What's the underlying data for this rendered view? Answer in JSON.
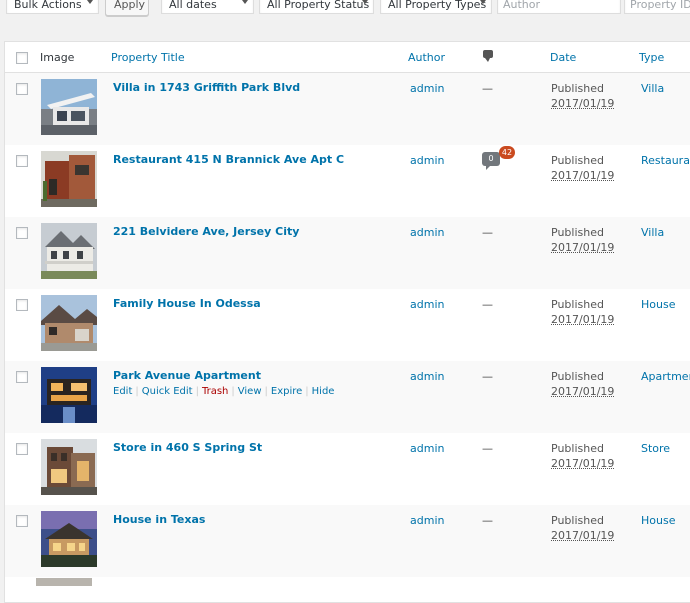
{
  "filters": {
    "bulk_actions": "Bulk Actions",
    "apply": "Apply",
    "dates": "All dates",
    "status": "All Property Status",
    "types": "All Property Types",
    "author_placeholder": "Author",
    "property_id_placeholder": "Property ID"
  },
  "columns": {
    "image": "Image",
    "title": "Property Title",
    "author": "Author",
    "comments_icon": "comment-bubble-icon",
    "date": "Date",
    "type": "Type"
  },
  "rows": [
    {
      "title": "Villa in 1743 Griffith Park Blvd",
      "author": "admin",
      "comments": "—",
      "status": "Published",
      "date": "2017/01/19",
      "type": "Villa"
    },
    {
      "title": "Restaurant 415 N Brannick Ave Apt C",
      "author": "admin",
      "comments": "0",
      "pending": "42",
      "status": "Published",
      "date": "2017/01/19",
      "type": "Restaurant"
    },
    {
      "title": "221 Belvidere Ave, Jersey City",
      "author": "admin",
      "comments": "—",
      "status": "Published",
      "date": "2017/01/19",
      "type": "Villa"
    },
    {
      "title": "Family House In Odessa",
      "author": "admin",
      "comments": "—",
      "status": "Published",
      "date": "2017/01/19",
      "type": "House"
    },
    {
      "title": "Park Avenue Apartment",
      "author": "admin",
      "comments": "—",
      "status": "Published",
      "date": "2017/01/19",
      "type": "Apartment",
      "actions": {
        "edit": "Edit",
        "quick_edit": "Quick Edit",
        "trash": "Trash",
        "view": "View",
        "expire": "Expire",
        "hide": "Hide"
      }
    },
    {
      "title": "Store in 460 S Spring St",
      "author": "admin",
      "comments": "—",
      "status": "Published",
      "date": "2017/01/19",
      "type": "Store"
    },
    {
      "title": "House in Texas",
      "author": "admin",
      "comments": "—",
      "status": "Published",
      "date": "2017/01/19",
      "type": "House"
    }
  ],
  "colors": {
    "link": "#0073aa",
    "trash": "#a00000",
    "pending_badge": "#ca4a1f"
  }
}
